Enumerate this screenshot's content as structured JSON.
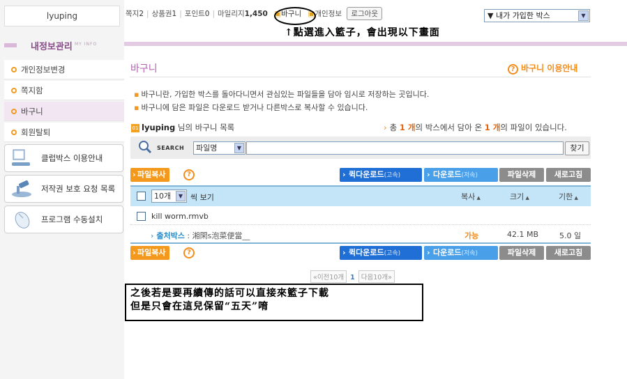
{
  "user": {
    "name": "lyuping"
  },
  "topbar": {
    "note_label": "쪽지",
    "note_count": "2",
    "coupon_label": "상품권",
    "coupon_count": "1",
    "point_label": "포인트",
    "point_count": "0",
    "mileage_label": "마일리지",
    "mileage_count": "1,450",
    "basket_label": "바구니",
    "profile_label": "개인정보",
    "logout_label": "로그아웃",
    "box_select_value": "▼ 내가 가입한 박스"
  },
  "annotations": {
    "top_note": "↑點選進入籃子，會出現以下畫面",
    "bottom_note_line1": "之後若是要再續傳的話可以直接來籃子下載",
    "bottom_note_line2": "但是只會在這兒保留“五天”唷"
  },
  "sidebar": {
    "title": "내정보관리",
    "subtitle": "MY INFO",
    "items": [
      {
        "label": "개인정보변경"
      },
      {
        "label": "쪽지함"
      },
      {
        "label": "바구니"
      },
      {
        "label": "회원탈퇴"
      }
    ],
    "boxes": [
      {
        "label": "클럽박스 이용안내"
      },
      {
        "label": "저작권 보호 요청 목록"
      },
      {
        "label": "프로그램 수동설치"
      }
    ]
  },
  "main": {
    "title": "바구니",
    "guide_label": "바구니 이용안내",
    "desc1": "바구니란, 가입한 박스를 돌아다니면서 관심있는 파일들을 담아 임시로 저장하는 곳입니다.",
    "desc2": "바구니에 담은 파일은 다운로드 받거나 다른박스로 복사할 수 있습니다.",
    "list_badge": "01",
    "list_user": "lyuping",
    "list_title_suffix": " 님의 바구니 목록",
    "summary_pre": "총 ",
    "summary_boxes": "1 개",
    "summary_mid": "의 박스에서 담아 온 ",
    "summary_files": "1 개",
    "summary_post": "의 파일이 있습니다."
  },
  "search": {
    "label": "SEARCH",
    "field_value": "파일명",
    "input_value": "",
    "button_label": "찾기"
  },
  "toolbar": {
    "copy_label": "파일복사",
    "help_label": "?",
    "quick_download_label": "퀵다운로드",
    "quick_download_sub": "(고속)",
    "download_label": "다운로드",
    "download_sub": "(저속)",
    "delete_label": "파일삭제",
    "refresh_label": "새로고침"
  },
  "table": {
    "perpage_value": "10개",
    "perpage_label": "씩 보기",
    "columns": {
      "copy": "복사",
      "size": "크기",
      "expire": "기한"
    },
    "rows": [
      {
        "filename": "kill worm.rmvb",
        "source_label": "출처박스",
        "source_value": " : 湘閑s泡菜便當__",
        "copy": "가능",
        "size": "42.1 MB",
        "expire": "5.0 일"
      }
    ]
  },
  "pager": {
    "prev": "이전10개",
    "current": "1",
    "next": "다음10개"
  },
  "colors": {
    "accent_purple": "#b45fb4",
    "accent_orange": "#f39a1e",
    "button_blue": "#1f6fd6",
    "table_head": "#c4e4f7"
  }
}
